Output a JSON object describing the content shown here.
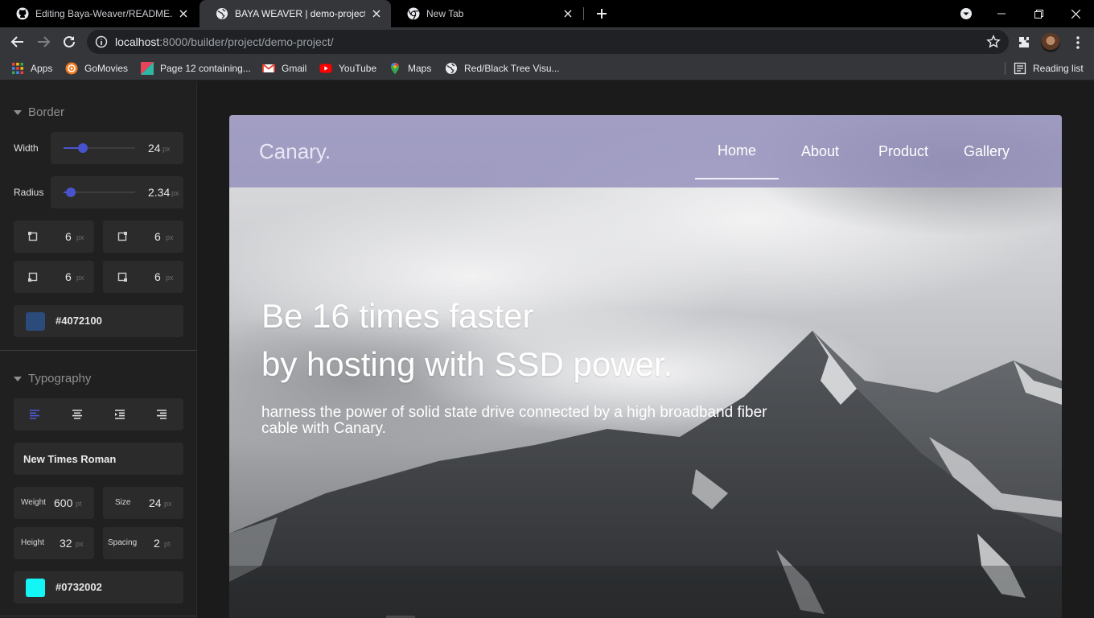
{
  "browser": {
    "tabs": [
      {
        "title": "Editing Baya-Weaver/README.m",
        "active": false
      },
      {
        "title": "BAYA WEAVER | demo-project",
        "active": true
      },
      {
        "title": "New Tab",
        "active": false
      }
    ],
    "url": {
      "host": "localhost",
      "rest": ":8000/builder/project/demo-project/"
    },
    "bookmarks": [
      {
        "label": "Apps",
        "icon": "apps-grid-icon"
      },
      {
        "label": "GoMovies",
        "icon": "gomovies-icon"
      },
      {
        "label": "Page 12 containing...",
        "icon": "page-icon"
      },
      {
        "label": "Gmail",
        "icon": "gmail-icon"
      },
      {
        "label": "YouTube",
        "icon": "youtube-icon"
      },
      {
        "label": "Maps",
        "icon": "maps-icon"
      },
      {
        "label": "Red/Black Tree Visu...",
        "icon": "globe-icon"
      }
    ],
    "reading_list": "Reading list"
  },
  "sidebar": {
    "border": {
      "title": "Border",
      "width": {
        "label": "Width",
        "value": "24",
        "unit": "px",
        "level": 0.27
      },
      "radius": {
        "label": "Radius",
        "value": "2.34",
        "unit": "px",
        "level": 0.1
      },
      "corners": [
        {
          "value": "6",
          "unit": "px"
        },
        {
          "value": "6",
          "unit": "px"
        },
        {
          "value": "6",
          "unit": "px"
        },
        {
          "value": "6",
          "unit": "px"
        }
      ],
      "color": {
        "hex": "#4072100",
        "swatch": "#2b4b7a"
      }
    },
    "typography": {
      "title": "Typography",
      "font": "New Times Roman",
      "weight": {
        "label": "Weight",
        "value": "600",
        "unit": "pt"
      },
      "size": {
        "label": "Size",
        "value": "24",
        "unit": "px"
      },
      "height": {
        "label": "Height",
        "value": "32",
        "unit": "px"
      },
      "spacing": {
        "label": "Spacing",
        "value": "2",
        "unit": "pt"
      },
      "color": {
        "hex": "#0732002",
        "swatch": "#14f6f6"
      }
    }
  },
  "preview": {
    "brand": "Canary.",
    "nav": [
      "Home",
      "About",
      "Product",
      "Gallery"
    ],
    "active_nav": "Home",
    "headline_1": "Be 16 times faster",
    "headline_2": "by hosting with SSD power.",
    "subline": "harness the power of solid state drive connected by a high broadband fiber cable with Canary."
  },
  "colors": {
    "accent": "#4653cc",
    "navbar_overlay": "#908aba"
  }
}
